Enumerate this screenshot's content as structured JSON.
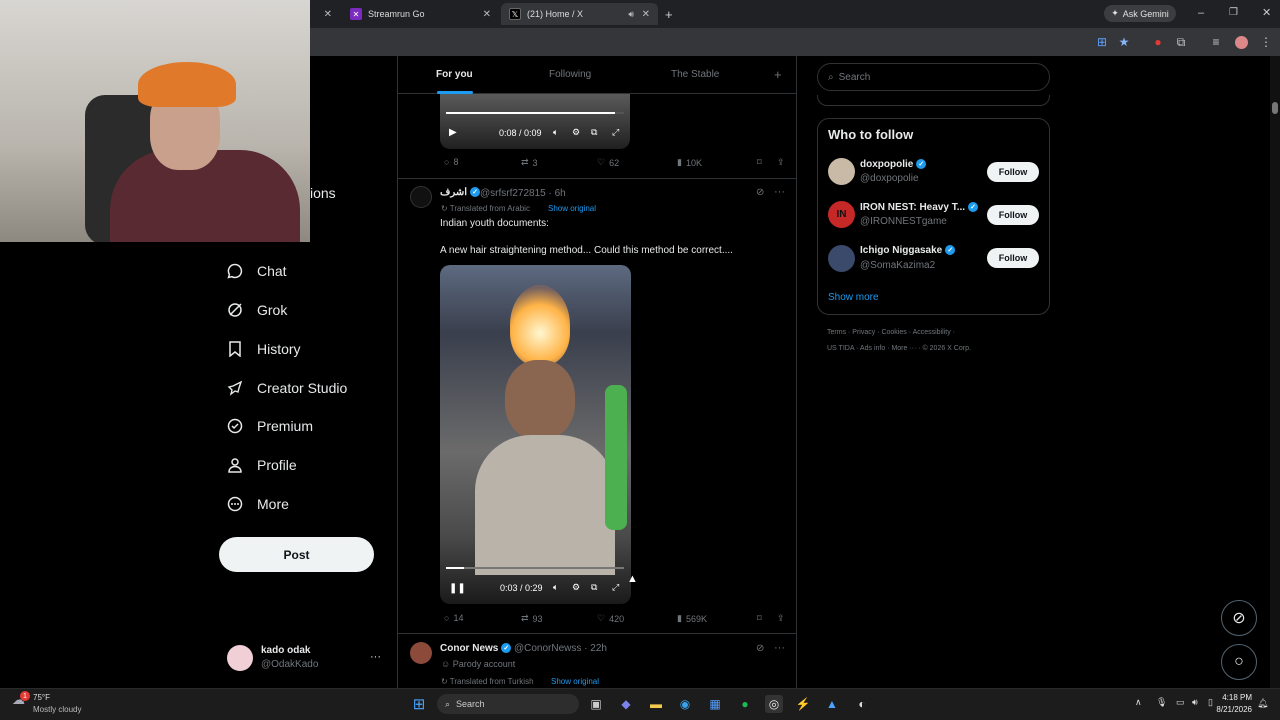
{
  "browser": {
    "tabs": [
      {
        "label": "Streamrun Go",
        "active": false
      },
      {
        "label": "(21) Home / X",
        "active": true
      }
    ],
    "gemini_label": "Ask Gemini"
  },
  "sidebar": {
    "partial_label": "ions",
    "items": [
      {
        "label": "Chat",
        "icon": "chat-icon"
      },
      {
        "label": "Grok",
        "icon": "grok-icon"
      },
      {
        "label": "History",
        "icon": "bookmark-icon"
      },
      {
        "label": "Creator Studio",
        "icon": "rocket-icon"
      },
      {
        "label": "Premium",
        "icon": "check-badge-icon"
      },
      {
        "label": "Profile",
        "icon": "person-icon"
      },
      {
        "label": "More",
        "icon": "more-circle-icon"
      }
    ],
    "post_label": "Post",
    "account": {
      "name": "kado odak",
      "handle": "@OdakKado",
      "menu": "···"
    }
  },
  "feed": {
    "tabs": [
      {
        "label": "For you",
        "selected": true
      },
      {
        "label": "Following",
        "selected": false
      },
      {
        "label": "The Stable",
        "selected": false
      }
    ],
    "add": "+",
    "top_video": {
      "time": "0:08 / 0:09",
      "progress": 0.95
    },
    "top_actions": {
      "replies": "8",
      "reposts": "3",
      "likes": "62",
      "views": "10K"
    },
    "post1": {
      "name": "اشرف",
      "handle": "@srfsrf272815 · 6h",
      "translated": "Translated from Arabic",
      "show_original": "Show original",
      "text1": "Indian youth documents:",
      "text2": "A new hair straightening method... Could this method be correct....",
      "video": {
        "time": "0:03 / 0:29",
        "progress": 0.1
      },
      "actions": {
        "replies": "14",
        "reposts": "93",
        "likes": "420",
        "views": "569K"
      }
    },
    "post2": {
      "name": "Conor News",
      "handle": "@ConorNewss · 22h",
      "parody": "Parody account",
      "translated": "Translated from Turkish",
      "show_original": "Show original"
    }
  },
  "right": {
    "search_placeholder": "Search",
    "who_to_follow": "Who to follow",
    "suggestions": [
      {
        "name": "doxpopolie",
        "handle": "@doxpopolie"
      },
      {
        "name": "IRON NEST: Heavy T...",
        "handle": "@IRONNESTgame"
      },
      {
        "name": "Ichigo Niggasake",
        "handle": "@SomaKazima2"
      }
    ],
    "follow_label": "Follow",
    "show_more": "Show more",
    "footer_line1": "Terms  ·  Privacy  ·  Cookies  ·  Accessibility  ·",
    "footer_line2": "US TIDA  ·  Ads info  ·  More ···  ·  © 2026 X Corp."
  },
  "taskbar": {
    "weather_temp": "75°F",
    "weather_desc": "Mostly cloudy",
    "search": "Search",
    "time": "4:18 PM",
    "date": "8/21/2026",
    "badge": "1"
  },
  "colors": {
    "accent": "#1d9bf0",
    "background": "#000000",
    "border": "#2f3336"
  }
}
